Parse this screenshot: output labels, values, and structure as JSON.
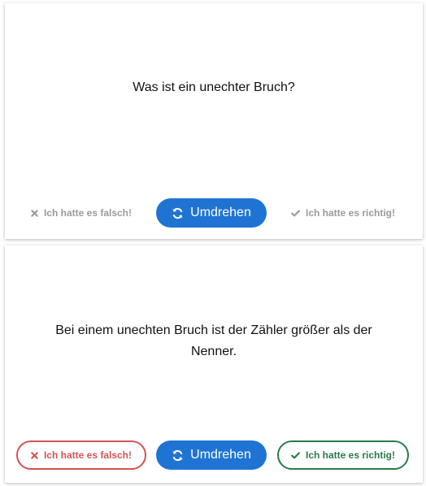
{
  "front": {
    "question": "Was ist ein unechter Bruch?",
    "wrong_label": "Ich hatte es falsch!",
    "flip_label": "Umdrehen",
    "right_label": "Ich hatte es richtig!"
  },
  "back": {
    "answer": "Bei einem unechten Bruch ist der Zähler größer als der Nenner.",
    "wrong_label": "Ich hatte es falsch!",
    "flip_label": "Umdrehen",
    "right_label": "Ich hatte es richtig!"
  },
  "icons": {
    "wrong": "close-icon",
    "flip": "refresh-icon",
    "right": "check-icon"
  },
  "colors": {
    "flip_button": "#1f74d3",
    "wrong": "#d05454",
    "right": "#2a7b4a",
    "disabled": "#9a9a9a"
  }
}
